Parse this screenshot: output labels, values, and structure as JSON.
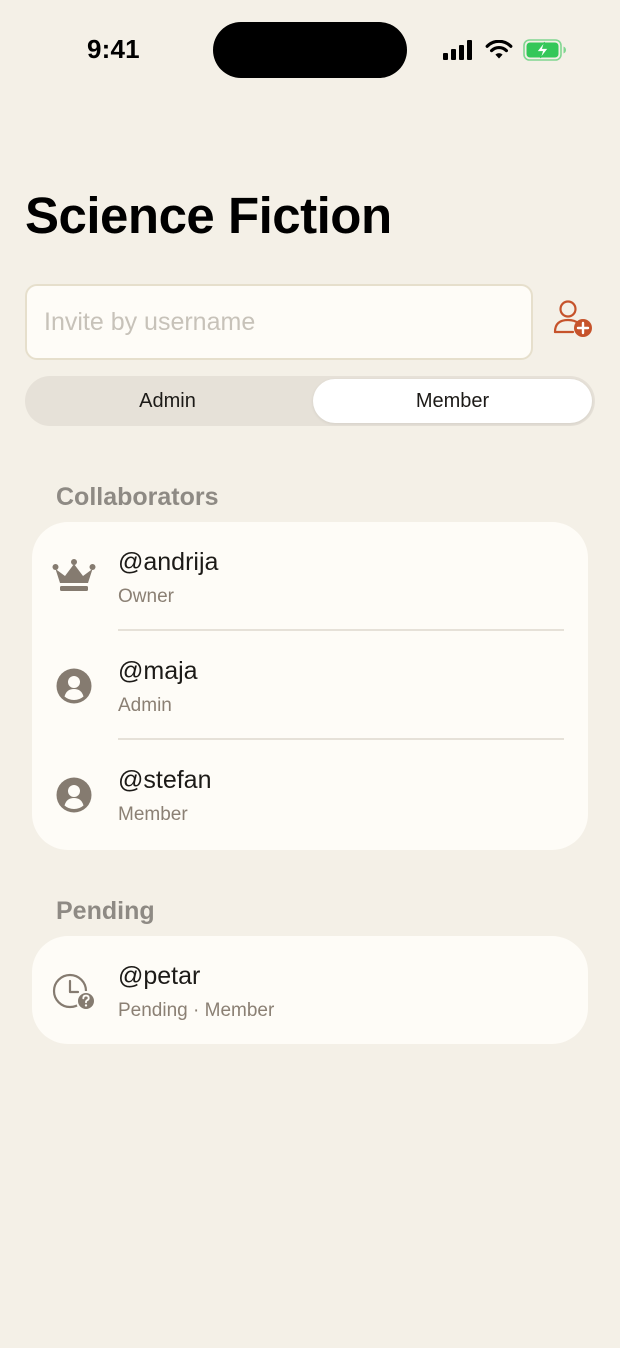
{
  "status_bar": {
    "time": "9:41"
  },
  "header": {
    "title": "Science Fiction"
  },
  "invite": {
    "placeholder": "Invite by username",
    "value": ""
  },
  "role_toggle": {
    "options": [
      "Admin",
      "Member"
    ],
    "selected": "Member"
  },
  "sections": {
    "collaborators": {
      "title": "Collaborators",
      "items": [
        {
          "username": "@andrija",
          "role": "Owner",
          "icon": "crown-icon"
        },
        {
          "username": "@maja",
          "role": "Admin",
          "icon": "person-circle-icon"
        },
        {
          "username": "@stefan",
          "role": "Member",
          "icon": "person-circle-icon"
        }
      ]
    },
    "pending": {
      "title": "Pending",
      "items": [
        {
          "username": "@petar",
          "status": "Pending · Member",
          "icon": "clock-question-icon"
        }
      ]
    }
  },
  "colors": {
    "background": "#f4f0e7",
    "card": "#fefcf7",
    "accent": "#c6532b",
    "icon": "#857b70",
    "battery": "#34c759"
  }
}
